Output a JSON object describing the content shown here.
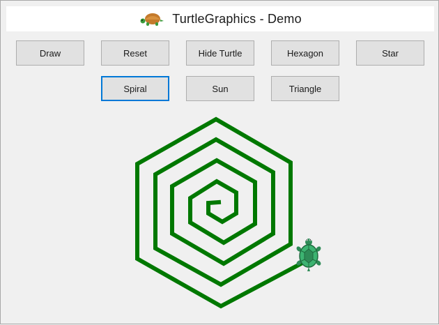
{
  "window": {
    "title": "TurtleGraphics - Demo",
    "icon": "turtle-icon"
  },
  "toolbar": {
    "buttons": [
      {
        "label": "Draw"
      },
      {
        "label": "Reset"
      },
      {
        "label": "Hide Turtle"
      },
      {
        "label": "Hexagon"
      },
      {
        "label": "Star"
      },
      {
        "label": "Spiral",
        "active": true
      },
      {
        "label": "Sun"
      },
      {
        "label": "Triangle"
      }
    ]
  },
  "drawing": {
    "shape": "hexagonal spiral",
    "stroke_color": "#007800",
    "turtle_icon": "turtle-icon",
    "turtle_color": "#2e8b57"
  }
}
